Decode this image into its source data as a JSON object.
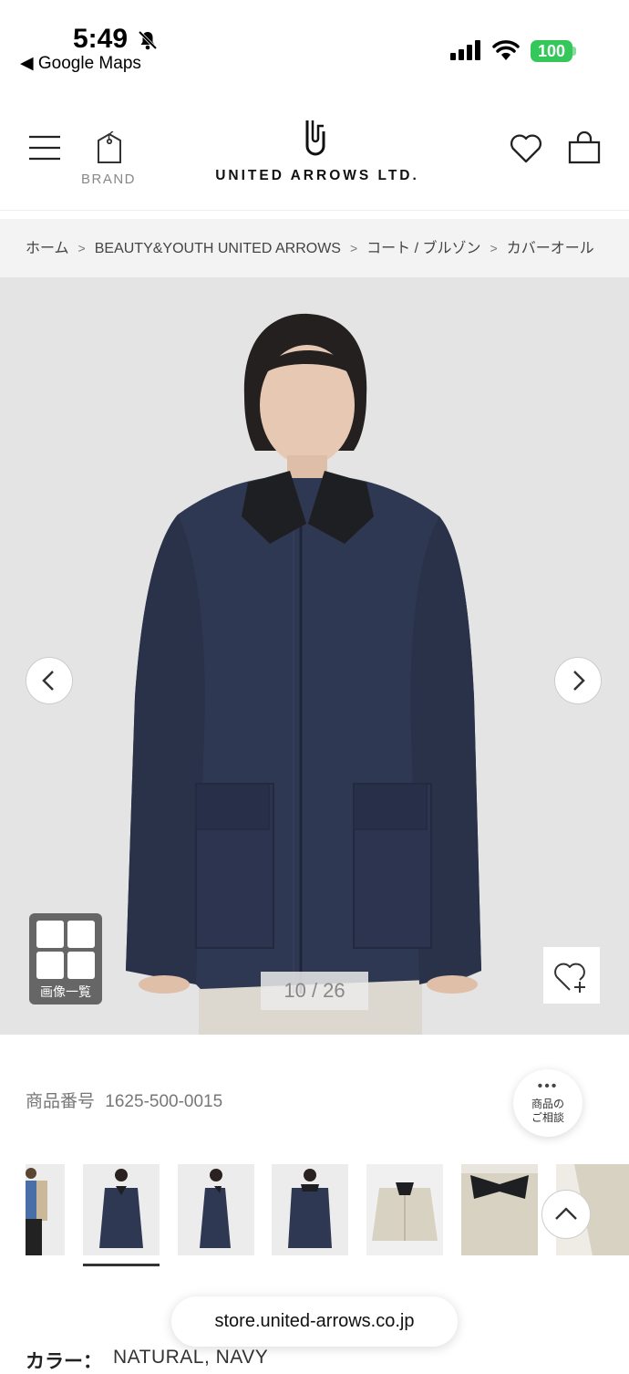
{
  "status_bar": {
    "time": "5:49",
    "back_app": "◀ Google Maps",
    "battery": "100"
  },
  "header": {
    "brand_label": "BRAND",
    "logo_text": "UNITED ARROWS LTD."
  },
  "breadcrumb": [
    "ホーム",
    "BEAUTY&YOUTH UNITED ARROWS",
    "コート / ブルゾン",
    "カバーオール"
  ],
  "gallery": {
    "button_label": "画像一覧",
    "counter": "10 / 26"
  },
  "product": {
    "number_label": "商品番号",
    "number": "1625-500-0015",
    "color_label": "カラー：",
    "color_value": "NATURAL, NAVY"
  },
  "consult": {
    "dots": "•••",
    "label_line1": "商品の",
    "label_line2": "ご相談"
  },
  "browser": {
    "url": "store.united-arrows.co.jp"
  },
  "colors": {
    "jacket_navy": "#2f3852",
    "collar_black": "#1e1f22",
    "beige": "#d8d2c2",
    "battery_green": "#34c759"
  }
}
